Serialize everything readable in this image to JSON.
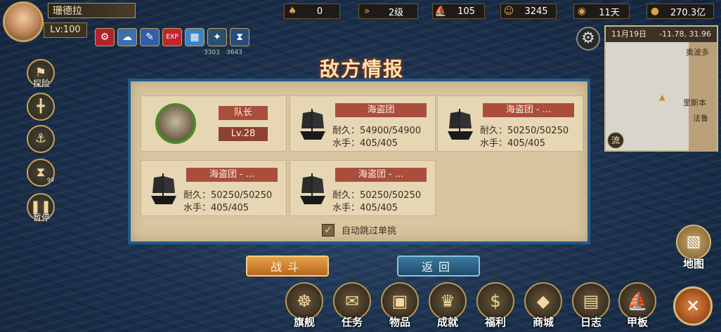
{
  "player": {
    "name": "珊德拉",
    "level": "Lv:100"
  },
  "buffs": [
    {
      "icon": "gear-buff-icon",
      "glyph": "⚙",
      "color": "#b2222a"
    },
    {
      "icon": "cloud-buff-icon",
      "glyph": "☁",
      "color": "#3b6fb0"
    },
    {
      "icon": "feather-buff-icon",
      "glyph": "✎",
      "color": "#2f5fa8"
    },
    {
      "icon": "exp-buff-icon",
      "glyph": "EXP",
      "color": "#c2262e"
    },
    {
      "icon": "chart-buff-icon",
      "glyph": "▦",
      "color": "#3d82c4"
    },
    {
      "icon": "map-buff-icon",
      "glyph": "✦",
      "color": "#2a4f6e"
    },
    {
      "icon": "hourglass-buff-icon",
      "glyph": "⧗",
      "color": "#244c7c"
    }
  ],
  "buff_counts": [
    "3303",
    "3643"
  ],
  "resources": [
    {
      "name": "resource-energy",
      "icon": "boot-icon",
      "glyph": "♠",
      "value": "0"
    },
    {
      "name": "resource-rank",
      "icon": "rank-arrows-icon",
      "glyph": "»",
      "value": "2级"
    },
    {
      "name": "resource-ship",
      "icon": "ship-icon",
      "glyph": "⛵",
      "value": "105"
    },
    {
      "name": "resource-crew",
      "icon": "sailor-icon",
      "glyph": "☺",
      "value": "3245"
    },
    {
      "name": "resource-food",
      "icon": "bread-icon",
      "glyph": "◉",
      "value": "11天"
    },
    {
      "name": "resource-gold",
      "icon": "coin-icon",
      "glyph": "●",
      "value": "270.3亿"
    }
  ],
  "minimap": {
    "date": "11月19日",
    "coords": "-11.78, 31.96",
    "places": [
      "奥波多",
      "里斯本",
      "法鲁"
    ],
    "flow_label": "流"
  },
  "side_menu": [
    {
      "name": "explore",
      "icon": "flag-icon",
      "glyph": "⚑",
      "label": "探险"
    },
    {
      "name": "grid",
      "icon": "cross-icon",
      "glyph": "╋",
      "label": ""
    },
    {
      "name": "anchor",
      "icon": "anchor-icon",
      "glyph": "⚓",
      "label": ""
    },
    {
      "name": "hourglass",
      "icon": "hourglass-icon",
      "glyph": "⧗",
      "label": ""
    },
    {
      "name": "pause",
      "icon": "pause-icon",
      "glyph": "❚❚",
      "label": "暂停"
    }
  ],
  "hourglass_badge": "99",
  "dialog": {
    "title": "敌方情报",
    "leader": {
      "badge": "队长",
      "level": "Lv.28"
    },
    "fleets": [
      {
        "name": "海盗团",
        "durability": "54900/54900",
        "crew": "405/405"
      },
      {
        "name": "海盗团 - ...",
        "durability": "50250/50250",
        "crew": "405/405"
      },
      {
        "name": "海盗团 - ...",
        "durability": "50250/50250",
        "crew": "405/405"
      },
      {
        "name": "海盗团 - ...",
        "durability": "50250/50250",
        "crew": "405/405"
      }
    ],
    "durability_label": "耐久：",
    "crew_label": "水手：",
    "auto_skip_label": "自动跳过单挑",
    "fight_label": "战斗",
    "back_label": "返回"
  },
  "bottom_menu": [
    {
      "name": "flagship",
      "icon": "ship-wheel-icon",
      "glyph": "☸",
      "label": "旗舰"
    },
    {
      "name": "quest",
      "icon": "scroll-icon",
      "glyph": "✉",
      "label": "任务"
    },
    {
      "name": "items",
      "icon": "chest-icon",
      "glyph": "▣",
      "label": "物品"
    },
    {
      "name": "achievements",
      "icon": "trophy-icon",
      "glyph": "♛",
      "label": "成就"
    },
    {
      "name": "welfare",
      "icon": "money-bag-icon",
      "glyph": "$",
      "label": "福利"
    },
    {
      "name": "shop",
      "icon": "treasure-chest-icon",
      "glyph": "◆",
      "label": "商城"
    },
    {
      "name": "journal",
      "icon": "book-icon",
      "glyph": "▤",
      "label": "日志"
    },
    {
      "name": "deck",
      "icon": "galleon-icon",
      "glyph": "⛵",
      "label": "甲板"
    }
  ],
  "map_button": {
    "icon": "map-scroll-icon",
    "glyph": "▧",
    "label": "地图"
  },
  "close_button": {
    "icon": "close-icon",
    "glyph": "✕"
  }
}
